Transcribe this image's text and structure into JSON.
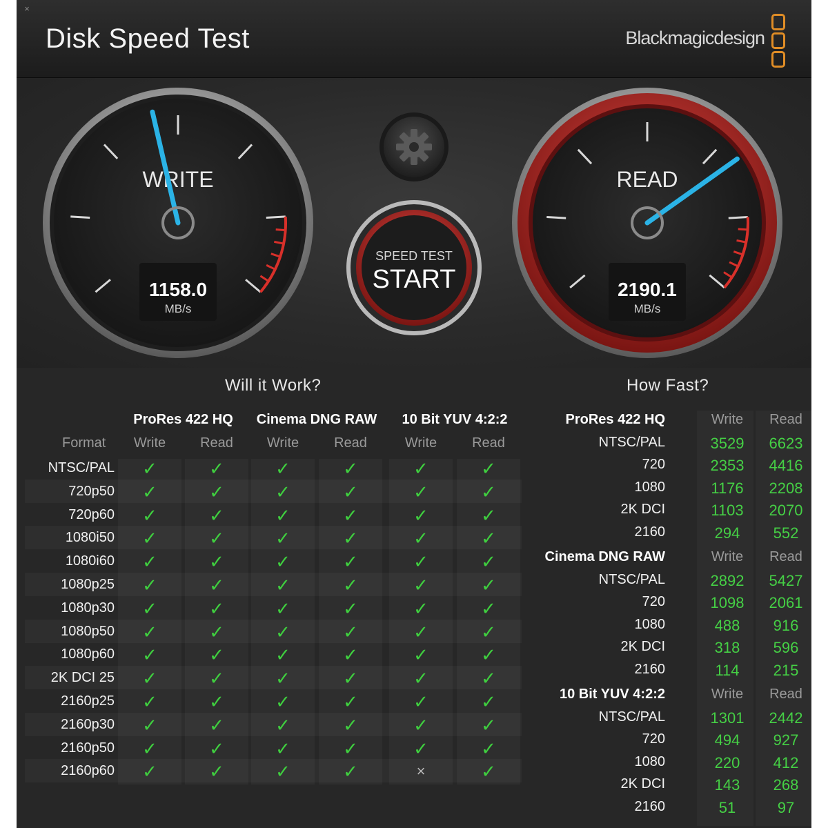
{
  "window": {
    "title": "Disk Speed Test",
    "brand": "Blackmagicdesign",
    "close_glyph": "×"
  },
  "gauges": {
    "write": {
      "label": "WRITE",
      "value": "1158.0",
      "unit": "MB/s",
      "needle_level": 0.45
    },
    "read": {
      "label": "READ",
      "value": "2190.1",
      "unit": "MB/s",
      "needle_level": 0.71
    }
  },
  "controls": {
    "settings_icon": "gear-icon",
    "start_top": "SPEED TEST",
    "start_main": "START"
  },
  "will_it_work": {
    "title": "Will it Work?",
    "format_header": "Format",
    "groups": [
      "ProRes 422 HQ",
      "Cinema DNG RAW",
      "10 Bit YUV 4:2:2"
    ],
    "subheaders": [
      "Write",
      "Read",
      "Write",
      "Read",
      "Write",
      "Read"
    ],
    "rows": [
      {
        "format": "NTSC/PAL",
        "results": [
          "✓",
          "✓",
          "✓",
          "✓",
          "✓",
          "✓"
        ]
      },
      {
        "format": "720p50",
        "results": [
          "✓",
          "✓",
          "✓",
          "✓",
          "✓",
          "✓"
        ]
      },
      {
        "format": "720p60",
        "results": [
          "✓",
          "✓",
          "✓",
          "✓",
          "✓",
          "✓"
        ]
      },
      {
        "format": "1080i50",
        "results": [
          "✓",
          "✓",
          "✓",
          "✓",
          "✓",
          "✓"
        ]
      },
      {
        "format": "1080i60",
        "results": [
          "✓",
          "✓",
          "✓",
          "✓",
          "✓",
          "✓"
        ]
      },
      {
        "format": "1080p25",
        "results": [
          "✓",
          "✓",
          "✓",
          "✓",
          "✓",
          "✓"
        ]
      },
      {
        "format": "1080p30",
        "results": [
          "✓",
          "✓",
          "✓",
          "✓",
          "✓",
          "✓"
        ]
      },
      {
        "format": "1080p50",
        "results": [
          "✓",
          "✓",
          "✓",
          "✓",
          "✓",
          "✓"
        ]
      },
      {
        "format": "1080p60",
        "results": [
          "✓",
          "✓",
          "✓",
          "✓",
          "✓",
          "✓"
        ]
      },
      {
        "format": "2K DCI 25",
        "results": [
          "✓",
          "✓",
          "✓",
          "✓",
          "✓",
          "✓"
        ]
      },
      {
        "format": "2160p25",
        "results": [
          "✓",
          "✓",
          "✓",
          "✓",
          "✓",
          "✓"
        ]
      },
      {
        "format": "2160p30",
        "results": [
          "✓",
          "✓",
          "✓",
          "✓",
          "✓",
          "✓"
        ]
      },
      {
        "format": "2160p50",
        "results": [
          "✓",
          "✓",
          "✓",
          "✓",
          "✓",
          "✓"
        ]
      },
      {
        "format": "2160p60",
        "results": [
          "✓",
          "✓",
          "✓",
          "✓",
          "×",
          "✓"
        ]
      }
    ]
  },
  "how_fast": {
    "title": "How Fast?",
    "sections": [
      {
        "name": "ProRes 422 HQ",
        "write_header": "Write",
        "read_header": "Read",
        "rows": [
          {
            "format": "NTSC/PAL",
            "write": "3529",
            "read": "6623"
          },
          {
            "format": "720",
            "write": "2353",
            "read": "4416"
          },
          {
            "format": "1080",
            "write": "1176",
            "read": "2208"
          },
          {
            "format": "2K DCI",
            "write": "1103",
            "read": "2070"
          },
          {
            "format": "2160",
            "write": "294",
            "read": "552"
          }
        ]
      },
      {
        "name": "Cinema DNG RAW",
        "write_header": "Write",
        "read_header": "Read",
        "rows": [
          {
            "format": "NTSC/PAL",
            "write": "2892",
            "read": "5427"
          },
          {
            "format": "720",
            "write": "1098",
            "read": "2061"
          },
          {
            "format": "1080",
            "write": "488",
            "read": "916"
          },
          {
            "format": "2K DCI",
            "write": "318",
            "read": "596"
          },
          {
            "format": "2160",
            "write": "114",
            "read": "215"
          }
        ]
      },
      {
        "name": "10 Bit YUV 4:2:2",
        "write_header": "Write",
        "read_header": "Read",
        "rows": [
          {
            "format": "NTSC/PAL",
            "write": "1301",
            "read": "2442"
          },
          {
            "format": "720",
            "write": "494",
            "read": "927"
          },
          {
            "format": "1080",
            "write": "220",
            "read": "412"
          },
          {
            "format": "2K DCI",
            "write": "143",
            "read": "268"
          },
          {
            "format": "2160",
            "write": "51",
            "read": "97"
          }
        ]
      }
    ]
  },
  "colors": {
    "accent_orange": "#e08d26",
    "needle_blue": "#2bb3e6",
    "redline": "#d8302a",
    "ok_green": "#3fcf3f"
  }
}
